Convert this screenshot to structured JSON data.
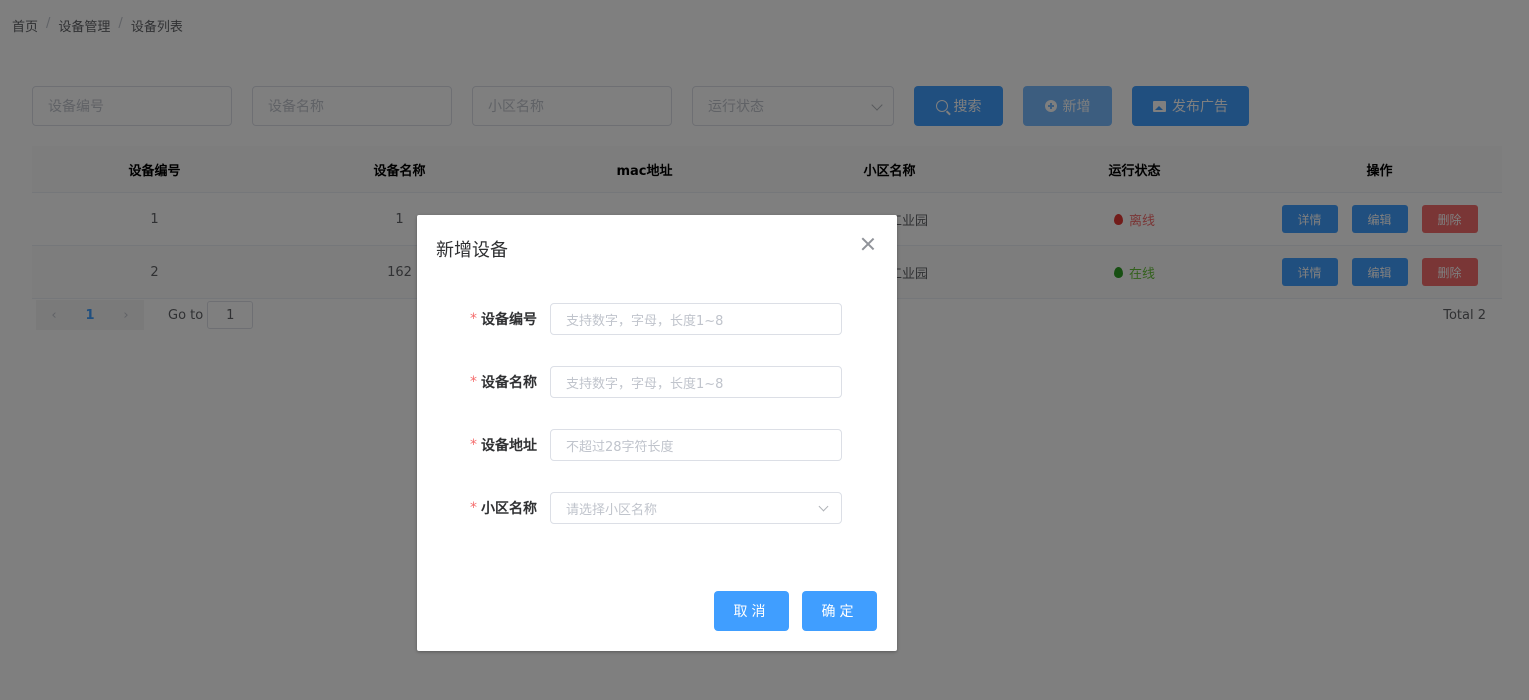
{
  "breadcrumb": [
    "首页",
    "设备管理",
    "设备列表"
  ],
  "breadcrumb_sep": "/",
  "filters": {
    "device_no_placeholder": "设备编号",
    "device_name_placeholder": "设备名称",
    "community_placeholder": "小区名称",
    "status_placeholder": "运行状态"
  },
  "buttons": {
    "search": "搜索",
    "add": "新增",
    "publish_ad": "发布广告"
  },
  "table": {
    "headers": [
      "设备编号",
      "设备名称",
      "mac地址",
      "小区名称",
      "运行状态",
      "操作"
    ],
    "rows": [
      {
        "no": "1",
        "name": "1",
        "mac": "",
        "community": "工业园",
        "status": "离线"
      },
      {
        "no": "2",
        "name": "162",
        "mac": "",
        "community": "工业园",
        "status": "在线"
      }
    ],
    "actions": {
      "detail": "详情",
      "edit": "编辑",
      "delete": "删除"
    }
  },
  "pagination": {
    "current_page": "1",
    "goto_label": "Go to",
    "goto_value": "1",
    "total": "Total 2"
  },
  "dialog": {
    "title": "新增设备",
    "required_mark": "*",
    "fields": [
      {
        "label": "设备编号",
        "placeholder": "支持数字，字母，长度1~8"
      },
      {
        "label": "设备名称",
        "placeholder": "支持数字，字母，长度1~8"
      },
      {
        "label": "设备地址",
        "placeholder": "不超过28字符长度"
      },
      {
        "label": "小区名称",
        "placeholder": "请选择小区名称"
      }
    ],
    "cancel": "取消",
    "confirm": "确定"
  },
  "colors": {
    "primary": "#409eff",
    "danger": "#f56c6c",
    "success": "#67c23a",
    "offline_dot": "#e53935",
    "online_dot": "#2e9f25"
  }
}
